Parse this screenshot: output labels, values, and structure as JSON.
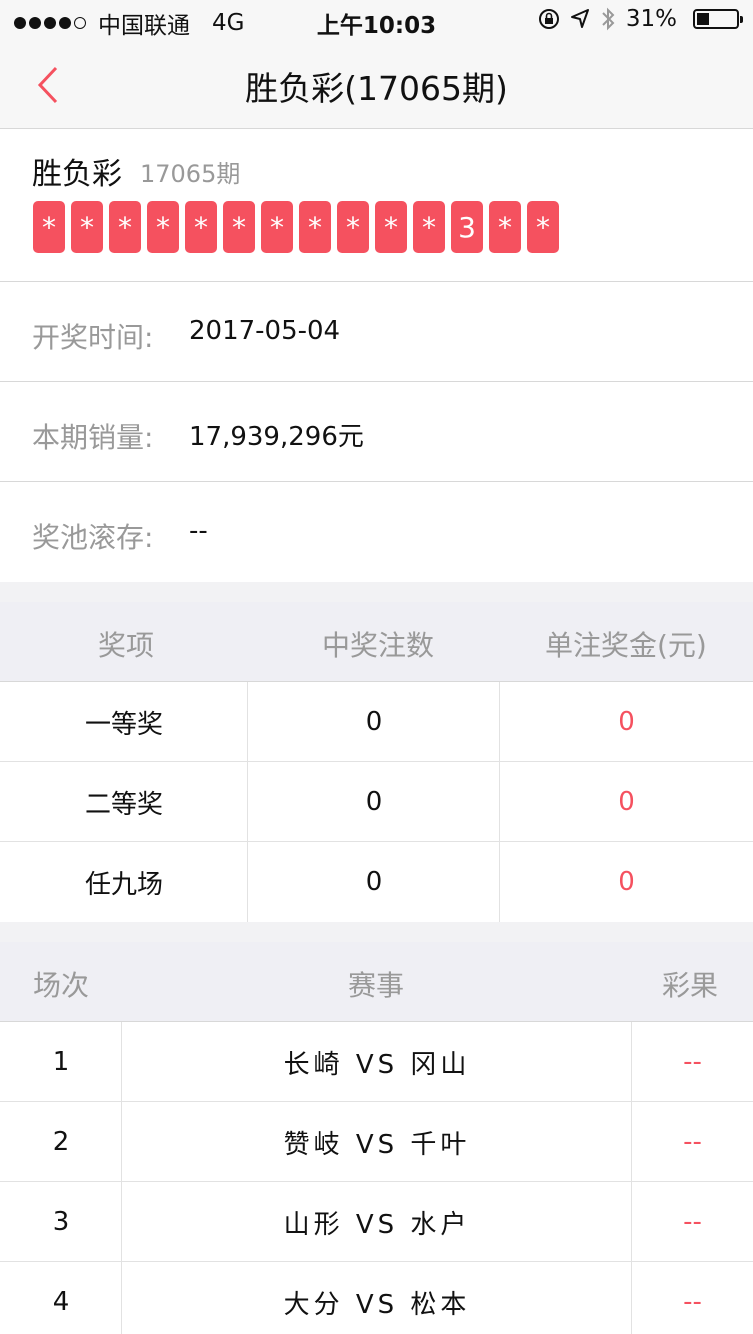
{
  "status_bar": {
    "carrier": "中国联通",
    "network": "4G",
    "time": "上午10:03",
    "battery": "31%",
    "battery_level": 0.31
  },
  "nav": {
    "title": "胜负彩(17065期)",
    "back_icon": "chevron-left-icon",
    "accent_color": "#f5515f"
  },
  "lottery": {
    "name": "胜负彩",
    "issue": "17065期",
    "balls": [
      "*",
      "*",
      "*",
      "*",
      "*",
      "*",
      "*",
      "*",
      "*",
      "*",
      "*",
      "3",
      "*",
      "*"
    ]
  },
  "info": {
    "draw_time_label": "开奖时间:",
    "draw_time_value": "2017-05-04",
    "sales_label": "本期销量:",
    "sales_value": "17,939,296元",
    "pool_label": "奖池滚存:",
    "pool_value": "--"
  },
  "prize_table": {
    "headers": [
      "奖项",
      "中奖注数",
      "单注奖金(元)"
    ],
    "rows": [
      {
        "name": "一等奖",
        "count": "0",
        "amount": "0"
      },
      {
        "name": "二等奖",
        "count": "0",
        "amount": "0"
      },
      {
        "name": "任九场",
        "count": "0",
        "amount": "0"
      }
    ]
  },
  "match_table": {
    "headers": [
      "场次",
      "赛事",
      "彩果"
    ],
    "rows": [
      {
        "no": "1",
        "match": "长崎 VS 冈山",
        "result": "--"
      },
      {
        "no": "2",
        "match": "赞岐 VS 千叶",
        "result": "--"
      },
      {
        "no": "3",
        "match": "山形 VS 水户",
        "result": "--"
      },
      {
        "no": "4",
        "match": "大分 VS 松本",
        "result": "--"
      }
    ]
  }
}
